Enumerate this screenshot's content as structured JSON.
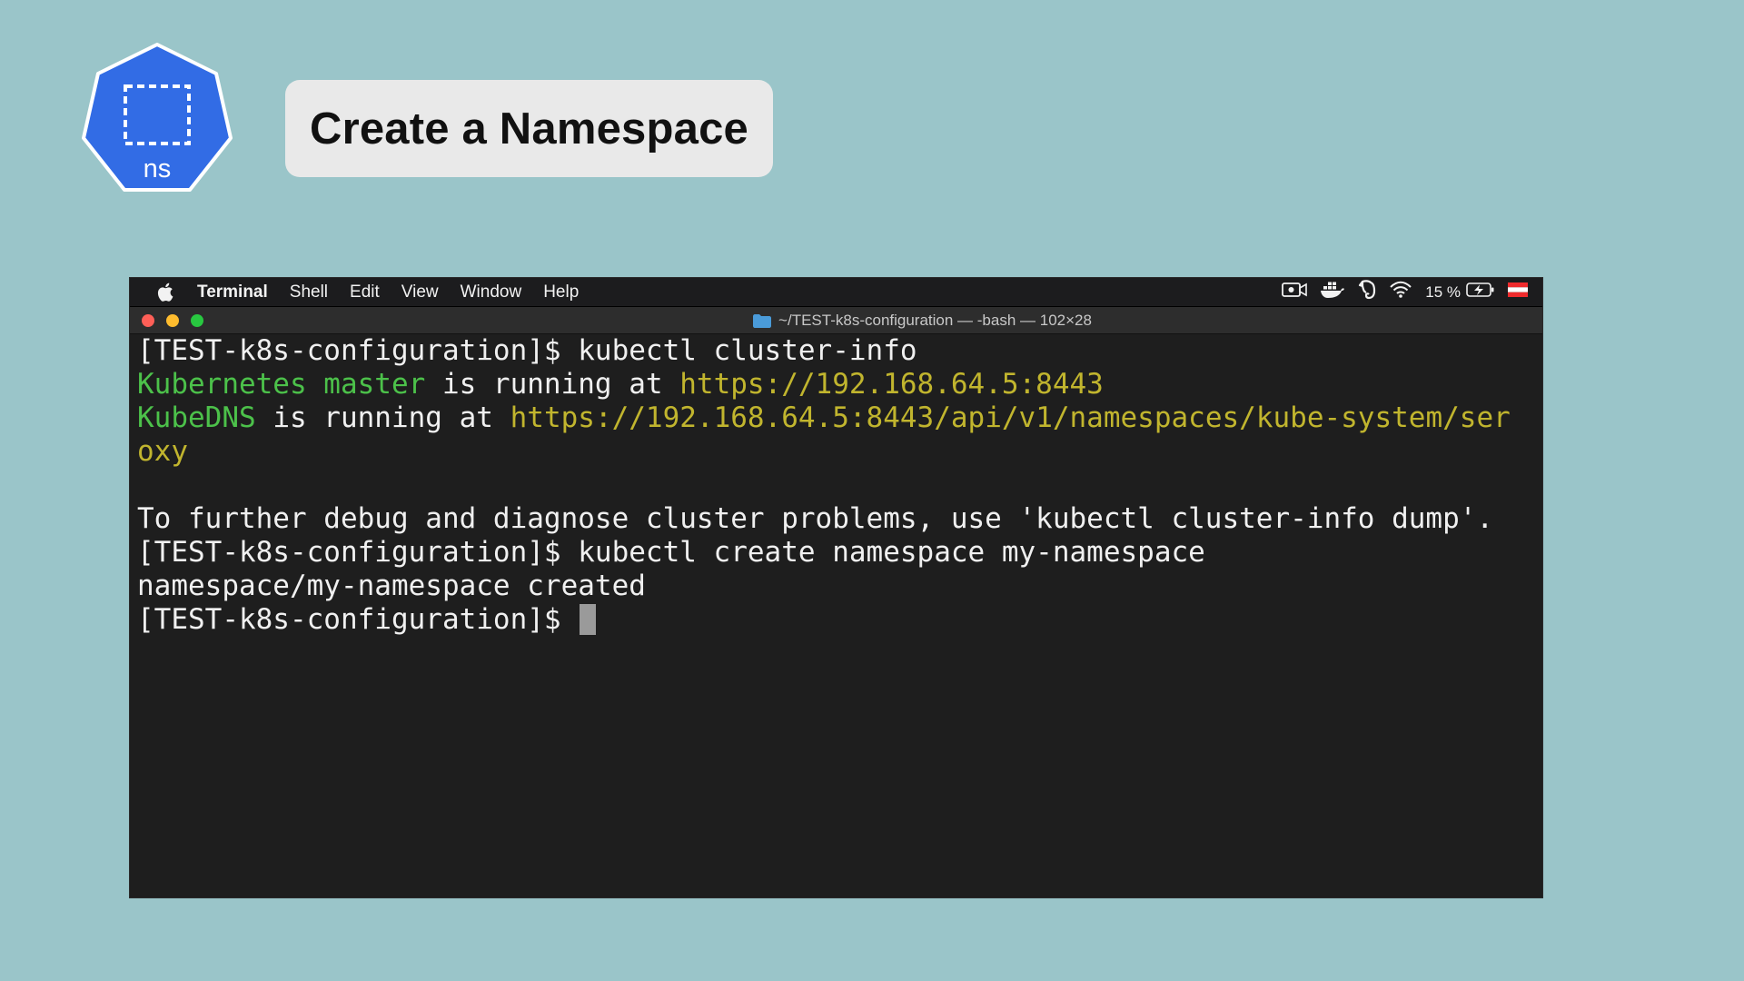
{
  "logo": {
    "label": "ns",
    "color": "#326ce5"
  },
  "slide": {
    "title": "Create a Namespace"
  },
  "menubar": {
    "items": [
      "Terminal",
      "Shell",
      "Edit",
      "View",
      "Window",
      "Help"
    ],
    "battery": "15 %",
    "icons": [
      "apple-icon",
      "screen-record-icon",
      "docker-icon",
      "evernote-icon",
      "wifi-icon",
      "battery-charging-icon",
      "flag-icon"
    ]
  },
  "window": {
    "title": "~/TEST-k8s-configuration — -bash — 102×28"
  },
  "terminal": {
    "lines": [
      {
        "segments": [
          {
            "text": "[TEST-k8s-configuration]$ kubectl cluster-info",
            "color": "white"
          }
        ]
      },
      {
        "segments": [
          {
            "text": "Kubernetes master",
            "color": "green"
          },
          {
            "text": " is running at ",
            "color": "white"
          },
          {
            "text": "https://192.168.64.5:8443",
            "color": "yellow"
          }
        ]
      },
      {
        "segments": [
          {
            "text": "KubeDNS",
            "color": "green"
          },
          {
            "text": " is running at ",
            "color": "white"
          },
          {
            "text": "https://192.168.64.5:8443/api/v1/namespaces/kube-system/ser",
            "color": "yellow"
          }
        ]
      },
      {
        "segments": [
          {
            "text": "oxy",
            "color": "yellow"
          }
        ]
      },
      {
        "segments": [
          {
            "text": "",
            "color": "white"
          }
        ]
      },
      {
        "segments": [
          {
            "text": "To further debug and diagnose cluster problems, use 'kubectl cluster-info dump'.",
            "color": "white"
          }
        ]
      },
      {
        "segments": [
          {
            "text": "[TEST-k8s-configuration]$ kubectl create namespace my-namespace",
            "color": "white"
          }
        ]
      },
      {
        "segments": [
          {
            "text": "namespace/my-namespace created",
            "color": "white"
          }
        ]
      },
      {
        "segments": [
          {
            "text": "[TEST-k8s-configuration]$ ",
            "color": "white"
          }
        ],
        "cursor": true
      }
    ],
    "colors": {
      "green": "#4cc14a",
      "yellow": "#c1b52e",
      "white": "#f0f0f0"
    }
  }
}
